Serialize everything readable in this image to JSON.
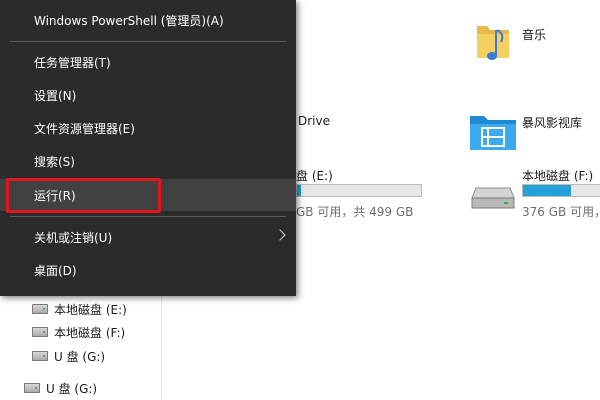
{
  "menu": {
    "items": [
      {
        "label": "Windows PowerShell (管理员)(A)"
      },
      {
        "label": "任务管理器(T)"
      },
      {
        "label": "设置(N)"
      },
      {
        "label": "文件资源管理器(E)"
      },
      {
        "label": "搜索(S)"
      },
      {
        "label": "运行(R)"
      },
      {
        "label": "关机或注销(U)"
      },
      {
        "label": "桌面(D)"
      }
    ],
    "highlight_color": "#e0161c"
  },
  "explorer": {
    "tree": [
      {
        "label": "本地磁盘 (E:)",
        "icon": "drive-icon"
      },
      {
        "label": "本地磁盘 (F:)",
        "icon": "drive-icon"
      },
      {
        "label": "U 盘 (G:)",
        "icon": "drive-icon"
      },
      {
        "label": "U 盘 (G:)",
        "icon": "drive-icon"
      }
    ],
    "tiles": {
      "music": {
        "label": "音乐",
        "icon": "music-folder-icon"
      },
      "onedrive": {
        "label_partial": "Drive"
      },
      "video": {
        "label": "暴风影视库",
        "icon": "video-folder-icon"
      },
      "drive_e": {
        "label_partial": "盘 (E:)",
        "usage_partial": "GB 可用，共 499 GB",
        "used_fraction": 0.03
      },
      "drive_f": {
        "label": "本地磁盘 (F:)",
        "usage_partial": "376 GB 可用，共",
        "used_fraction": 0.62,
        "icon": "hard-drive-icon"
      }
    },
    "accent": "#26a0da"
  }
}
